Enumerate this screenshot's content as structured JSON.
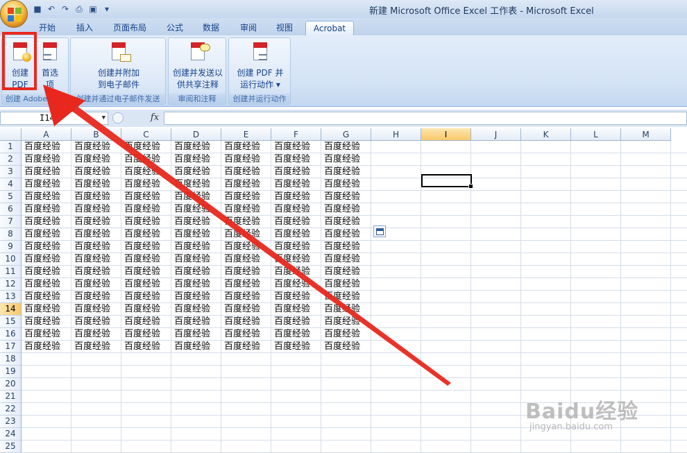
{
  "window": {
    "title": "新建 Microsoft Office Excel 工作表 - Microsoft Excel"
  },
  "tabs": [
    {
      "label": "开始"
    },
    {
      "label": "插入"
    },
    {
      "label": "页面布局"
    },
    {
      "label": "公式"
    },
    {
      "label": "数据"
    },
    {
      "label": "审阅"
    },
    {
      "label": "视图"
    },
    {
      "label": "Acrobat",
      "active": true
    }
  ],
  "ribbon": {
    "groups": [
      {
        "label": "创建 Adobe PDF",
        "buttons": [
          {
            "label": "创建\nPDF",
            "icon": "create-pdf-icon"
          },
          {
            "label": "首选\n项",
            "icon": "preferences-icon"
          }
        ]
      },
      {
        "label": "创建并通过电子邮件发送",
        "buttons": [
          {
            "label": "创建并附加\n到电子邮件",
            "icon": "attach-email-icon"
          }
        ]
      },
      {
        "label": "审阅和注释",
        "buttons": [
          {
            "label": "创建并发送以\n供共享注释",
            "icon": "send-comment-icon"
          }
        ]
      },
      {
        "label": "创建并运行动作",
        "buttons": [
          {
            "label": "创建 PDF 并\n运行动作 ▾",
            "icon": "run-action-icon"
          }
        ]
      }
    ]
  },
  "formula_bar": {
    "name_box": "I14",
    "fx": "fx",
    "value": ""
  },
  "sheet": {
    "columns": [
      "A",
      "B",
      "C",
      "D",
      "E",
      "F",
      "G",
      "H",
      "I",
      "J",
      "K",
      "L",
      "M"
    ],
    "rows": [
      "1",
      "2",
      "3",
      "4",
      "5",
      "6",
      "7",
      "8",
      "9",
      "10",
      "11",
      "12",
      "13",
      "14",
      "15",
      "16",
      "17",
      "18",
      "19",
      "20",
      "21",
      "22",
      "23",
      "24",
      "25"
    ],
    "cell_text": "百度经验",
    "filled_rows": 17,
    "filled_cols": 7,
    "selected_cell": "I14"
  },
  "watermark": {
    "text": "Baidu经验",
    "sub": "jingyan.baidu.com"
  },
  "colors": {
    "highlight": "#e8281e",
    "arrow": "#e8281e"
  }
}
